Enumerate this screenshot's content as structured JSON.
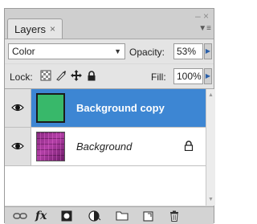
{
  "panel": {
    "tab_label": "Layers",
    "tab_close": "×",
    "window_close": "– ×",
    "menu_icon": "▼≡"
  },
  "blend": {
    "mode": "Color",
    "opacity_label": "Opacity:",
    "opacity_value": "53%"
  },
  "lock": {
    "label": "Lock:",
    "icons": [
      "lock-transparent-icon",
      "lock-image-icon",
      "lock-position-icon",
      "lock-all-icon"
    ],
    "fill_label": "Fill:",
    "fill_value": "100%"
  },
  "layers": [
    {
      "name": "Background copy",
      "visible": true,
      "selected": true,
      "thumb_color": "#38b86a",
      "locked": false
    },
    {
      "name": "Background",
      "visible": true,
      "selected": false,
      "thumb_color": "#a0359a",
      "locked": true
    }
  ],
  "toolbar": {
    "fx_label": "fx",
    "icons": [
      "link-layers-icon",
      "fx-icon",
      "add-mask-icon",
      "adjustment-layer-icon",
      "new-group-icon",
      "new-layer-icon",
      "delete-layer-icon"
    ]
  },
  "colors": {
    "selection": "#3d86d3",
    "panel_bg": "#d9d9d9"
  }
}
